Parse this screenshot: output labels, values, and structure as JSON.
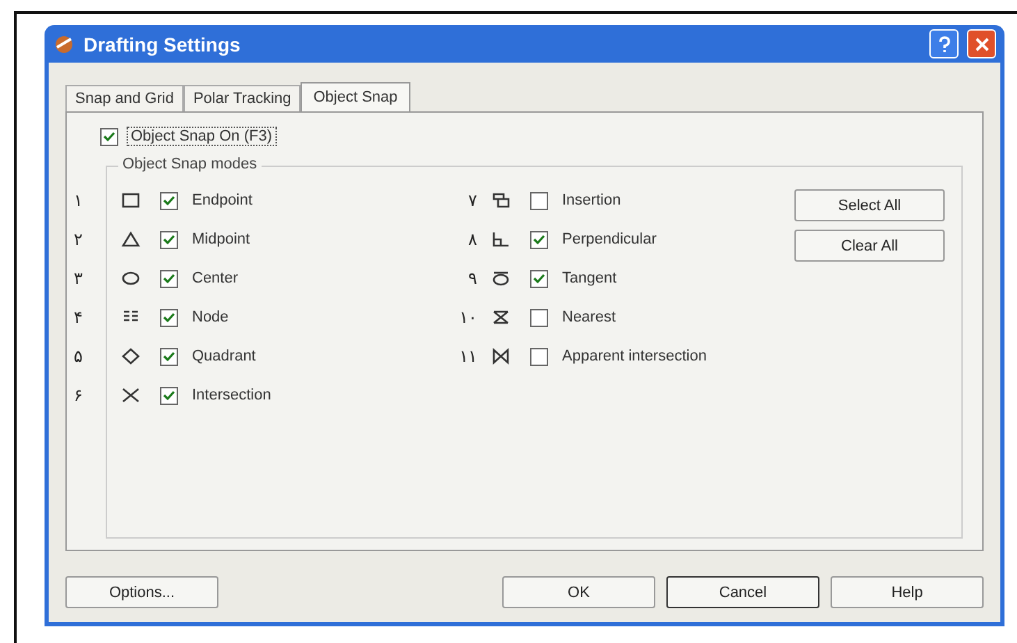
{
  "window": {
    "title": "Drafting Settings"
  },
  "tabs": [
    {
      "label": "Snap and Grid",
      "selected": false
    },
    {
      "label": "Polar Tracking",
      "selected": false
    },
    {
      "label": "Object Snap",
      "selected": true
    }
  ],
  "snap_on": {
    "label": "Object Snap On (F3)",
    "checked": true
  },
  "group": {
    "title": "Object Snap modes"
  },
  "modes_left": [
    {
      "number": "۱",
      "label": "Endpoint",
      "checked": true
    },
    {
      "number": "۲",
      "label": "Midpoint",
      "checked": true
    },
    {
      "number": "۳",
      "label": "Center",
      "checked": true
    },
    {
      "number": "۴",
      "label": "Node",
      "checked": true
    },
    {
      "number": "۵",
      "label": "Quadrant",
      "checked": true
    },
    {
      "number": "۶",
      "label": "Intersection",
      "checked": true
    }
  ],
  "modes_right": [
    {
      "number": "۷",
      "label": "Insertion",
      "checked": false
    },
    {
      "number": "۸",
      "label": "Perpendicular",
      "checked": true
    },
    {
      "number": "۹",
      "label": "Tangent",
      "checked": true
    },
    {
      "number": "۱۰",
      "label": "Nearest",
      "checked": false
    },
    {
      "number": "۱۱",
      "label": "Apparent intersection",
      "checked": false
    }
  ],
  "side_buttons": [
    "Select All",
    "Clear All"
  ],
  "footer": {
    "options": "Options...",
    "buttons": [
      "OK",
      "Cancel",
      "Help"
    ]
  }
}
